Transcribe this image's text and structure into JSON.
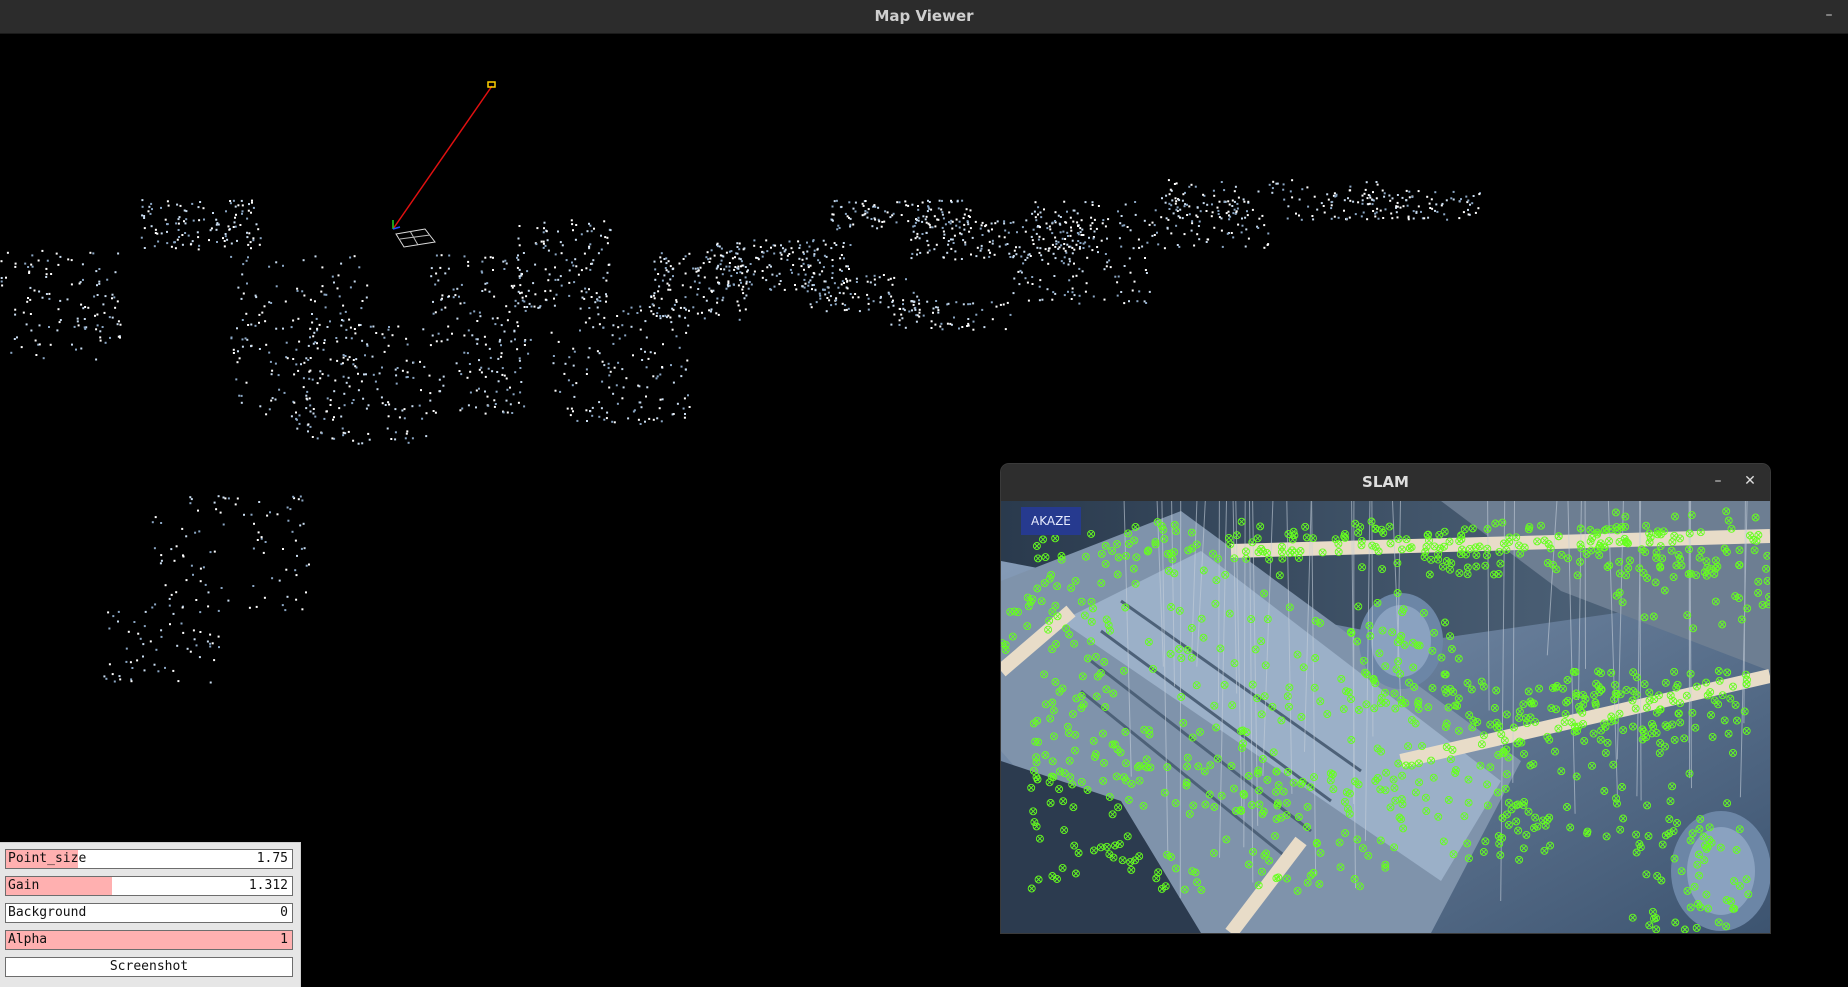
{
  "window": {
    "title": "Map Viewer",
    "minimize_glyph": "–"
  },
  "controls": {
    "sliders": [
      {
        "label": "Point_size",
        "value": "1.75",
        "fill_fraction": 0.25
      },
      {
        "label": "Gain",
        "value": "1.312",
        "fill_fraction": 0.37
      },
      {
        "label": "Background",
        "value": "0",
        "fill_fraction": 0.0
      },
      {
        "label": "Alpha",
        "value": "1",
        "fill_fraction": 1.0
      }
    ],
    "screenshot_label": "Screenshot"
  },
  "slam_window": {
    "title": "SLAM",
    "minimize_glyph": "–",
    "close_glyph": "✕",
    "detector_badge": "AKAZE"
  },
  "colors": {
    "titlebar_bg": "#2c2c2c",
    "point_cloud": "#c9dcf0",
    "slider_fill": "#ffb0b0",
    "badge_bg": "#263a8f",
    "keypoint": "#66ff1f",
    "trajectory": "#e01010"
  },
  "icons": [
    "minimize-icon",
    "close-icon",
    "camera-frustum-icon"
  ]
}
